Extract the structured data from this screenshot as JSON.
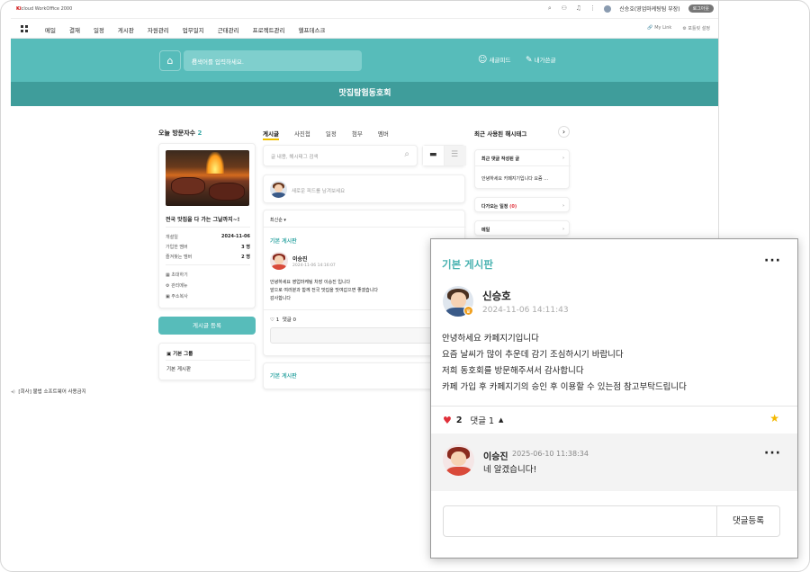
{
  "app": {
    "logo_brand": "Ki",
    "logo_text": "cloud WorkOffice 2000"
  },
  "topbar": {
    "user": "신승호(영업마케팅팀 부장)",
    "logout": "로그아웃"
  },
  "nav": {
    "items": [
      "메일",
      "결재",
      "일정",
      "게시판",
      "자원관리",
      "업무일지",
      "근태관리",
      "프로젝트관리",
      "헬프데스크"
    ],
    "my_link": "My Link",
    "settings": "포틀릿 설정"
  },
  "hero": {
    "search_placeholder": "검색어를 입력하세요.",
    "new_feed": "새글피드",
    "my_posts": "내가쓴글"
  },
  "board": {
    "title": "맛집탐험동호회"
  },
  "left": {
    "visitors_label": "오늘 방문자수",
    "visitors_count": "2",
    "club_desc": "전국 맛집을 다 가는 그날까지~!",
    "rows": [
      {
        "k": "개설일",
        "v": "2024-11-06"
      },
      {
        "k": "가입한 멤버",
        "v": "3 명"
      },
      {
        "k": "즐겨찾는 멤버",
        "v": "2 명"
      }
    ],
    "links": [
      "초대하기",
      "관리메뉴",
      "주소복사"
    ],
    "register_btn": "게시글 등록",
    "group_label": "기본 그룹",
    "group_item": "기본 게시판"
  },
  "center": {
    "tabs": [
      "게시글",
      "사진첩",
      "일정",
      "첨부",
      "멤버"
    ],
    "search_placeholder": "글 내용, 해시태그 검색",
    "feed_placeholder": "새로운 피드를 남겨보세요",
    "sort": "최신순",
    "post": {
      "board": "기본 게시판",
      "author": "이승진",
      "date": "2024-11-06 14:16:07",
      "lines": [
        "안녕하세요 영업마케팅 차장 이승진 입니다",
        "앞으로 여러분과 함께 전국 맛집을 맛여갑으면 좋겠습니다",
        "감사합니다"
      ],
      "likes": "1",
      "comments": "댓글 0"
    },
    "next_board": "기본 게시판"
  },
  "right": {
    "hashtag_title": "최근 사용된 해시태그",
    "recent_comment": "최근 댓글 작성된 글",
    "recent_text": "안녕하세요 카페지기입니다 요즘 …",
    "upcoming": "다가오는 일정",
    "upcoming_count": "(0)",
    "mail": "메일"
  },
  "notice": "[회사] 불법 소프트웨어 사용금지",
  "popup": {
    "board": "기본 게시판",
    "author": "신승호",
    "date": "2024-11-06 14:11:43",
    "lines": [
      "안녕하세요 카페지기입니다",
      "요즘 날씨가 많이 추운데 감기 조심하시기 바랍니다",
      "저희 동호회를 방문해주셔서 감사합니다",
      "카페 가입 후 카페지기의 승인 후 이용할 수 있는점 참고부탁드립니다"
    ],
    "likes": "2",
    "comments": "댓글 1",
    "comment": {
      "author": "이승진",
      "date": "2025-06-10 11:38:34",
      "text": "네 알겠습니다!"
    },
    "submit": "댓글등록"
  }
}
